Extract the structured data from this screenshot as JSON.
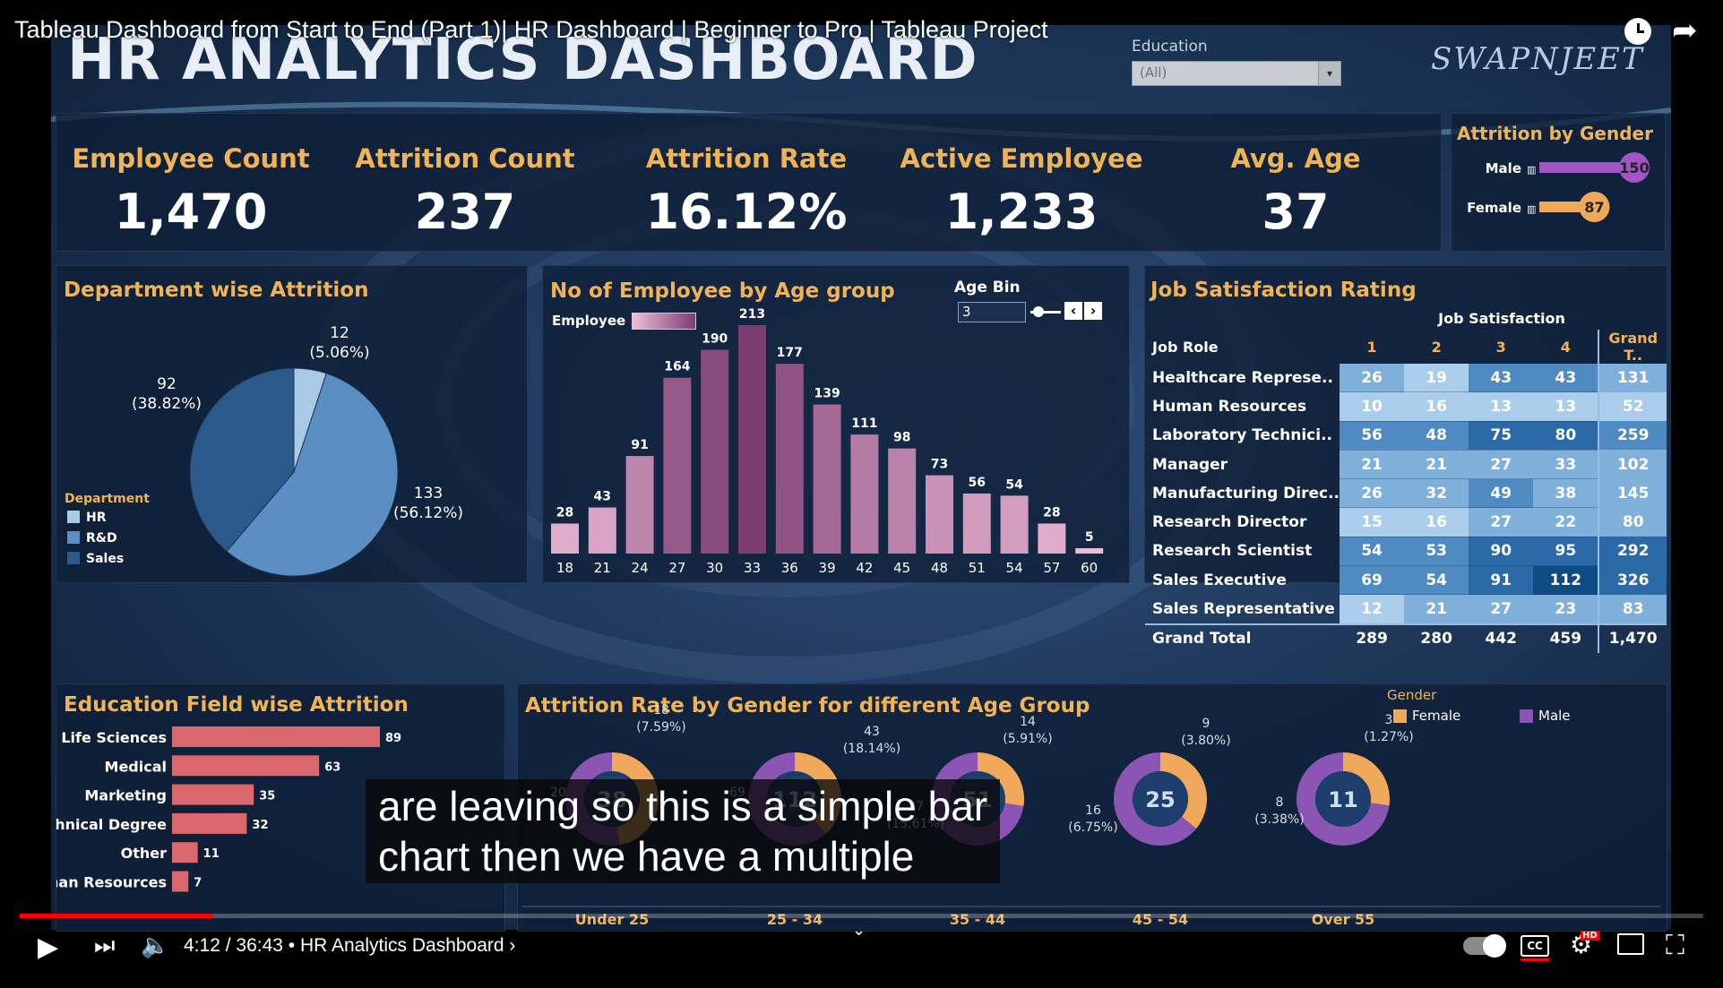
{
  "video": {
    "title": "Tableau Dashboard from Start to End (Part 1)| HR Dashboard | Beginner to Pro | Tableau Project",
    "time_current": "4:12",
    "time_total": "36:43",
    "chapter": "HR Analytics Dashboard",
    "progress": 0.1144,
    "caption_line1": "are leaving so this is a simple bar",
    "caption_line2": "chart then we have a multiple"
  },
  "header": {
    "title": "HR ANALYTICS DASHBOARD",
    "filter_label": "Education",
    "filter_value": "(All)",
    "brand": "SWAPNJEET"
  },
  "kpis": [
    {
      "label": "Employee Count",
      "value": "1,470"
    },
    {
      "label": "Attrition Count",
      "value": "237"
    },
    {
      "label": "Attrition Rate",
      "value": "16.12%"
    },
    {
      "label": "Active Employee",
      "value": "1,233"
    },
    {
      "label": "Avg. Age",
      "value": "37"
    }
  ],
  "gender_attrition": {
    "title": "Attrition by Gender",
    "male_label": "Male",
    "female_label": "Female",
    "male_value": 150,
    "female_value": 87,
    "male_text": "150",
    "female_text": "87"
  },
  "dept": {
    "title": "Department wise Attrition",
    "legend_title": "Department",
    "legend_items": [
      "HR",
      "R&D",
      "Sales"
    ],
    "label_hr": [
      "12",
      "(5.06%)"
    ],
    "label_rd": [
      "133",
      "(56.12%)"
    ],
    "label_sales": [
      "92",
      "(38.82%)"
    ]
  },
  "age_chart": {
    "title": "No of Employee by Age group",
    "legend_label": "Employee ..",
    "bin_label": "Age Bin",
    "bin_value": "3"
  },
  "job_sat": {
    "title": "Job Satisfaction Rating",
    "super_header": "Job Satisfaction",
    "col_role": "Job Role",
    "cols": [
      "1",
      "2",
      "3",
      "4"
    ],
    "col_total": "Grand T..",
    "rows": [
      {
        "role": "Healthcare Represe..",
        "v": [
          "26",
          "19",
          "43",
          "43"
        ],
        "t": "131"
      },
      {
        "role": "Human Resources",
        "v": [
          "10",
          "16",
          "13",
          "13"
        ],
        "t": "52"
      },
      {
        "role": "Laboratory Technici..",
        "v": [
          "56",
          "48",
          "75",
          "80"
        ],
        "t": "259"
      },
      {
        "role": "Manager",
        "v": [
          "21",
          "21",
          "27",
          "33"
        ],
        "t": "102"
      },
      {
        "role": "Manufacturing Direc..",
        "v": [
          "26",
          "32",
          "49",
          "38"
        ],
        "t": "145"
      },
      {
        "role": "Research Director",
        "v": [
          "15",
          "16",
          "27",
          "22"
        ],
        "t": "80"
      },
      {
        "role": "Research Scientist",
        "v": [
          "54",
          "53",
          "90",
          "95"
        ],
        "t": "292"
      },
      {
        "role": "Sales Executive",
        "v": [
          "69",
          "54",
          "91",
          "112"
        ],
        "t": "326"
      },
      {
        "role": "Sales Representative",
        "v": [
          "12",
          "21",
          "27",
          "23"
        ],
        "t": "83"
      }
    ],
    "total_label": "Grand Total",
    "totals": [
      "289",
      "280",
      "442",
      "459"
    ],
    "grand_total": "1,470"
  },
  "edu": {
    "title": "Education Field wise Attrition"
  },
  "gender_age": {
    "title": "Attrition Rate by Gender for different Age Group",
    "legend_title": "Gender",
    "legend_female": "Female",
    "legend_male": "Male"
  },
  "colors": {
    "accent_title": "#f0b355",
    "pie_hr": "#a9cbe8",
    "pie_rd": "#5b8ec2",
    "pie_sales": "#2b5a8a",
    "bar_edu": "#d9676b",
    "female": "#f0a85a",
    "male": "#8a55b5"
  },
  "chart_data": [
    {
      "type": "pie",
      "title": "Department wise Attrition",
      "categories": [
        "HR",
        "R&D",
        "Sales"
      ],
      "values": [
        12,
        133,
        92
      ],
      "labels": [
        "12\n(5.06%)",
        "133\n(56.12%)",
        "92\n(38.82%)"
      ],
      "legend": "bottom-left"
    },
    {
      "type": "bar",
      "title": "No of Employee by Age group",
      "categories": [
        "18",
        "21",
        "24",
        "27",
        "30",
        "33",
        "36",
        "39",
        "42",
        "45",
        "48",
        "51",
        "54",
        "57",
        "60"
      ],
      "values": [
        28,
        43,
        91,
        164,
        190,
        213,
        177,
        139,
        111,
        98,
        73,
        56,
        54,
        28,
        5
      ]
    },
    {
      "type": "bar",
      "title": "Education Field wise Attrition",
      "categories": [
        "Life Sciences",
        "Medical",
        "Marketing",
        "Technical Degree",
        "Other",
        "Human Resources"
      ],
      "values": [
        89,
        63,
        35,
        32,
        11,
        7
      ]
    },
    {
      "type": "bar",
      "title": "Attrition by Gender",
      "categories": [
        "Male",
        "Female"
      ],
      "values": [
        150,
        87
      ]
    },
    {
      "type": "pie",
      "title": "Attrition Rate by Gender for different Age Group",
      "categories": [
        "Under 25",
        "25 - 34",
        "35 - 44",
        "45 - 54",
        "Over 55"
      ],
      "series": [
        {
          "name": "Female",
          "values": [
            18,
            43,
            14,
            9,
            3
          ],
          "labels": [
            "18\n(7.59%)",
            "43\n(18.14%)",
            "14\n(5.91%)",
            "9\n(3.80%)",
            "3\n(1.27%)"
          ]
        },
        {
          "name": "Male",
          "values": [
            20,
            69,
            37,
            16,
            8
          ],
          "labels": [
            "20",
            "69",
            "37\n(15.61%)",
            "16\n(6.75%)",
            "8\n(3.38%)"
          ]
        }
      ],
      "center_values": [
        "38",
        "112",
        "51",
        "25",
        "11"
      ]
    }
  ]
}
